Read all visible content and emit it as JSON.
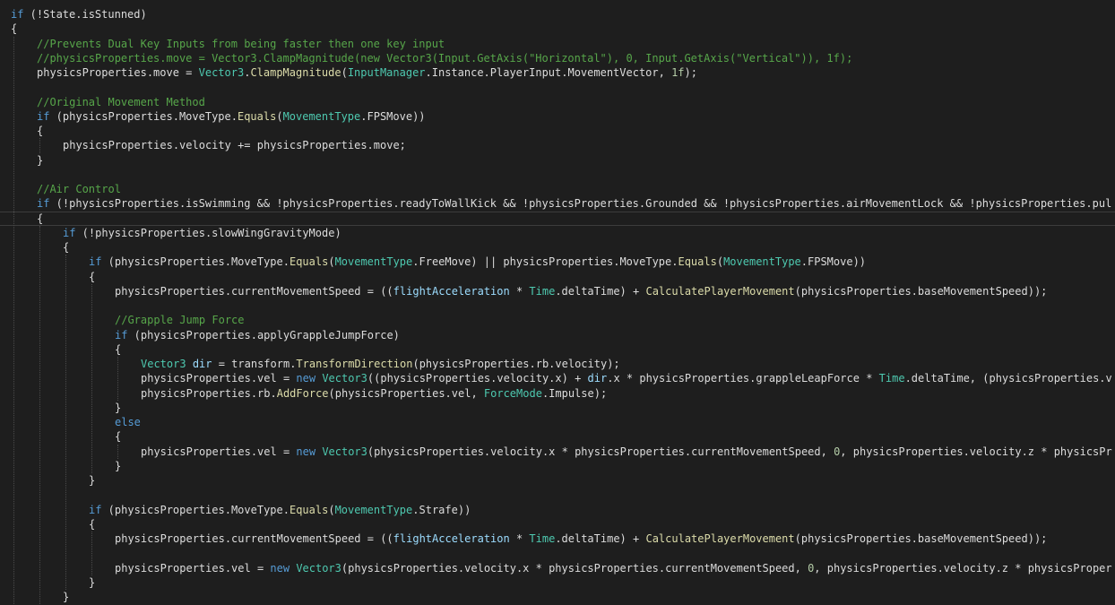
{
  "editor": {
    "colors": {
      "background": "#1e1e1e",
      "keyword": "#569cd6",
      "type": "#4ec9b0",
      "method": "#dcdcaa",
      "comment": "#57a64a",
      "string": "#d69d85",
      "number": "#b5cea8",
      "plain": "#dcdcdc",
      "field": "#9cdcfe"
    },
    "lines": [
      {
        "indent": 0,
        "tokens": [
          [
            "k",
            "if"
          ],
          [
            "p",
            " (!State.isStunned)"
          ]
        ]
      },
      {
        "indent": 0,
        "tokens": [
          [
            "p",
            "{"
          ]
        ]
      },
      {
        "indent": 1,
        "tokens": [
          [
            "c",
            "//Prevents Dual Key Inputs from being faster then one key input"
          ]
        ]
      },
      {
        "indent": 1,
        "tokens": [
          [
            "c",
            "//physicsProperties.move = Vector3.ClampMagnitude(new Vector3(Input.GetAxis(\"Horizontal\"), 0, Input.GetAxis(\"Vertical\")), 1f);"
          ]
        ]
      },
      {
        "indent": 1,
        "tokens": [
          [
            "p",
            "physicsProperties.move = "
          ],
          [
            "t",
            "Vector3"
          ],
          [
            "p",
            "."
          ],
          [
            "f",
            "ClampMagnitude"
          ],
          [
            "p",
            "("
          ],
          [
            "t",
            "InputManager"
          ],
          [
            "p",
            ".Instance.PlayerInput.MovementVector, "
          ],
          [
            "n",
            "1f"
          ],
          [
            "p",
            ");"
          ]
        ]
      },
      {
        "indent": 1,
        "tokens": []
      },
      {
        "indent": 1,
        "tokens": [
          [
            "c",
            "//Original Movement Method"
          ]
        ]
      },
      {
        "indent": 1,
        "tokens": [
          [
            "k",
            "if"
          ],
          [
            "p",
            " (physicsProperties.MoveType."
          ],
          [
            "f",
            "Equals"
          ],
          [
            "p",
            "("
          ],
          [
            "t",
            "MovementType"
          ],
          [
            "p",
            ".FPSMove))"
          ]
        ]
      },
      {
        "indent": 1,
        "tokens": [
          [
            "p",
            "{"
          ]
        ]
      },
      {
        "indent": 2,
        "tokens": [
          [
            "p",
            "physicsProperties.velocity += physicsProperties.move;"
          ]
        ]
      },
      {
        "indent": 1,
        "tokens": [
          [
            "p",
            "}"
          ]
        ]
      },
      {
        "indent": 1,
        "tokens": []
      },
      {
        "indent": 1,
        "tokens": [
          [
            "c",
            "//Air Control"
          ]
        ]
      },
      {
        "indent": 1,
        "tokens": [
          [
            "k",
            "if"
          ],
          [
            "p",
            " (!physicsProperties.isSwimming && !physicsProperties.readyToWallKick && !physicsProperties.Grounded && !physicsProperties.airMovementLock && !physicsProperties.pul"
          ]
        ]
      },
      {
        "indent": 1,
        "tokens": [
          [
            "p",
            "{"
          ]
        ]
      },
      {
        "indent": 2,
        "tokens": [
          [
            "k",
            "if"
          ],
          [
            "p",
            " (!physicsProperties.slowWingGravityMode)"
          ]
        ]
      },
      {
        "indent": 2,
        "tokens": [
          [
            "p",
            "{"
          ]
        ]
      },
      {
        "indent": 3,
        "tokens": [
          [
            "k",
            "if"
          ],
          [
            "p",
            " (physicsProperties.MoveType."
          ],
          [
            "f",
            "Equals"
          ],
          [
            "p",
            "("
          ],
          [
            "t",
            "MovementType"
          ],
          [
            "p",
            ".FreeMove) || physicsProperties.MoveType."
          ],
          [
            "f",
            "Equals"
          ],
          [
            "p",
            "("
          ],
          [
            "t",
            "MovementType"
          ],
          [
            "p",
            ".FPSMove))"
          ]
        ]
      },
      {
        "indent": 3,
        "tokens": [
          [
            "p",
            "{"
          ]
        ]
      },
      {
        "indent": 4,
        "tokens": [
          [
            "p",
            "physicsProperties.currentMovementSpeed = (("
          ],
          [
            "v",
            "flightAcceleration"
          ],
          [
            "p",
            " * "
          ],
          [
            "t",
            "Time"
          ],
          [
            "p",
            ".deltaTime) + "
          ],
          [
            "f",
            "CalculatePlayerMovement"
          ],
          [
            "p",
            "(physicsProperties.baseMovementSpeed));"
          ]
        ]
      },
      {
        "indent": 4,
        "tokens": []
      },
      {
        "indent": 4,
        "tokens": [
          [
            "c",
            "//Grapple Jump Force"
          ]
        ]
      },
      {
        "indent": 4,
        "tokens": [
          [
            "k",
            "if"
          ],
          [
            "p",
            " (physicsProperties.applyGrappleJumpForce)"
          ]
        ]
      },
      {
        "indent": 4,
        "tokens": [
          [
            "p",
            "{"
          ]
        ]
      },
      {
        "indent": 5,
        "tokens": [
          [
            "t",
            "Vector3"
          ],
          [
            "p",
            " "
          ],
          [
            "v",
            "dir"
          ],
          [
            "p",
            " = transform."
          ],
          [
            "f",
            "TransformDirection"
          ],
          [
            "p",
            "(physicsProperties.rb.velocity);"
          ]
        ]
      },
      {
        "indent": 5,
        "tokens": [
          [
            "p",
            "physicsProperties.vel = "
          ],
          [
            "k",
            "new"
          ],
          [
            "p",
            " "
          ],
          [
            "t",
            "Vector3"
          ],
          [
            "p",
            "((physicsProperties.velocity.x) + "
          ],
          [
            "v",
            "dir"
          ],
          [
            "p",
            ".x * physicsProperties.grappleLeapForce * "
          ],
          [
            "t",
            "Time"
          ],
          [
            "p",
            ".deltaTime, (physicsProperties.v"
          ]
        ]
      },
      {
        "indent": 5,
        "tokens": [
          [
            "p",
            "physicsProperties.rb."
          ],
          [
            "f",
            "AddForce"
          ],
          [
            "p",
            "(physicsProperties.vel, "
          ],
          [
            "t",
            "ForceMode"
          ],
          [
            "p",
            ".Impulse);"
          ]
        ]
      },
      {
        "indent": 4,
        "tokens": [
          [
            "p",
            "}"
          ]
        ]
      },
      {
        "indent": 4,
        "tokens": [
          [
            "k",
            "else"
          ]
        ]
      },
      {
        "indent": 4,
        "tokens": [
          [
            "p",
            "{"
          ]
        ]
      },
      {
        "indent": 5,
        "tokens": [
          [
            "p",
            "physicsProperties.vel = "
          ],
          [
            "k",
            "new"
          ],
          [
            "p",
            " "
          ],
          [
            "t",
            "Vector3"
          ],
          [
            "p",
            "(physicsProperties.velocity.x * physicsProperties.currentMovementSpeed, "
          ],
          [
            "n",
            "0"
          ],
          [
            "p",
            ", physicsProperties.velocity.z * physicsPr"
          ]
        ]
      },
      {
        "indent": 4,
        "tokens": [
          [
            "p",
            "}"
          ]
        ]
      },
      {
        "indent": 3,
        "tokens": [
          [
            "p",
            "}"
          ]
        ]
      },
      {
        "indent": 3,
        "tokens": []
      },
      {
        "indent": 3,
        "tokens": [
          [
            "k",
            "if"
          ],
          [
            "p",
            " (physicsProperties.MoveType."
          ],
          [
            "f",
            "Equals"
          ],
          [
            "p",
            "("
          ],
          [
            "t",
            "MovementType"
          ],
          [
            "p",
            ".Strafe))"
          ]
        ]
      },
      {
        "indent": 3,
        "tokens": [
          [
            "p",
            "{"
          ]
        ]
      },
      {
        "indent": 4,
        "tokens": [
          [
            "p",
            "physicsProperties.currentMovementSpeed = (("
          ],
          [
            "v",
            "flightAcceleration"
          ],
          [
            "p",
            " * "
          ],
          [
            "t",
            "Time"
          ],
          [
            "p",
            ".deltaTime) + "
          ],
          [
            "f",
            "CalculatePlayerMovement"
          ],
          [
            "p",
            "(physicsProperties.baseMovementSpeed));"
          ]
        ]
      },
      {
        "indent": 4,
        "tokens": []
      },
      {
        "indent": 4,
        "tokens": [
          [
            "p",
            "physicsProperties.vel = "
          ],
          [
            "k",
            "new"
          ],
          [
            "p",
            " "
          ],
          [
            "t",
            "Vector3"
          ],
          [
            "p",
            "(physicsProperties.velocity.x * physicsProperties.currentMovementSpeed, "
          ],
          [
            "n",
            "0"
          ],
          [
            "p",
            ", physicsProperties.velocity.z * physicsProper"
          ]
        ]
      },
      {
        "indent": 3,
        "tokens": [
          [
            "p",
            "}"
          ]
        ]
      },
      {
        "indent": 2,
        "tokens": [
          [
            "p",
            "}"
          ]
        ]
      }
    ]
  }
}
